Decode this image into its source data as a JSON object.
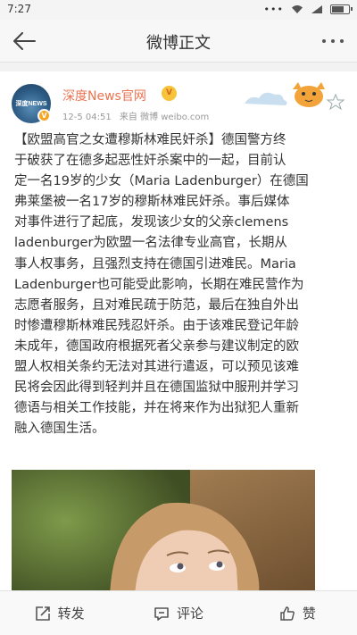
{
  "status_bar": {
    "time": "7:27",
    "icons": [
      "more-icon",
      "wifi-icon",
      "signal-icon",
      "battery-icon"
    ],
    "battery_level": 0.75
  },
  "nav": {
    "title": "微博正文",
    "back_icon": "back-arrow-icon",
    "more_icon": "more-icon"
  },
  "post": {
    "user_name": "深度News官网",
    "member_badge": "V",
    "verified_icon": "verified-badge-icon",
    "timestamp": "12-5 04:51",
    "source": "来自 微博 weibo.com",
    "avatar_text": "深度NEWS",
    "lines": [
      "【欧盟高官之女遭穆斯林难民奸杀】德国警方终",
      "于破获了在德多起恶性奸杀案中的一起，目前认",
      "定一名19岁的少女（Maria Ladenburger）在德国",
      "弗莱堡被一名17岁的穆斯林难民奸杀。事后媒体",
      "对事件进行了起底，发现该少女的父亲clemens",
      "ladenburger为欧盟一名法律专业高官，长期从",
      "事人权事务，且强烈支持在德国引进难民。Maria",
      "Ladenburger也可能受此影响，长期在难民营作为",
      "志愿者服务，且对难民疏于防范，最后在独自外出",
      "时惨遭穆斯林难民残忍奸杀。由于该难民登记年龄",
      "未成年，德国政府根据死者父亲参与建议制定的欧",
      "盟人权相关条约无法对其进行遣返，可以预见该难",
      "民将会因此得到轻判并且在德国监狱中服刑并学习",
      "德语与相关工作技能，并在将来作为出狱犯人重新",
      "融入德国生活。"
    ]
  },
  "toolbar": {
    "repost_label": "转发",
    "comment_label": "评论",
    "like_label": "赞",
    "repost_icon": "repost-icon",
    "comment_icon": "comment-icon",
    "like_icon": "thumbs-up-icon"
  }
}
